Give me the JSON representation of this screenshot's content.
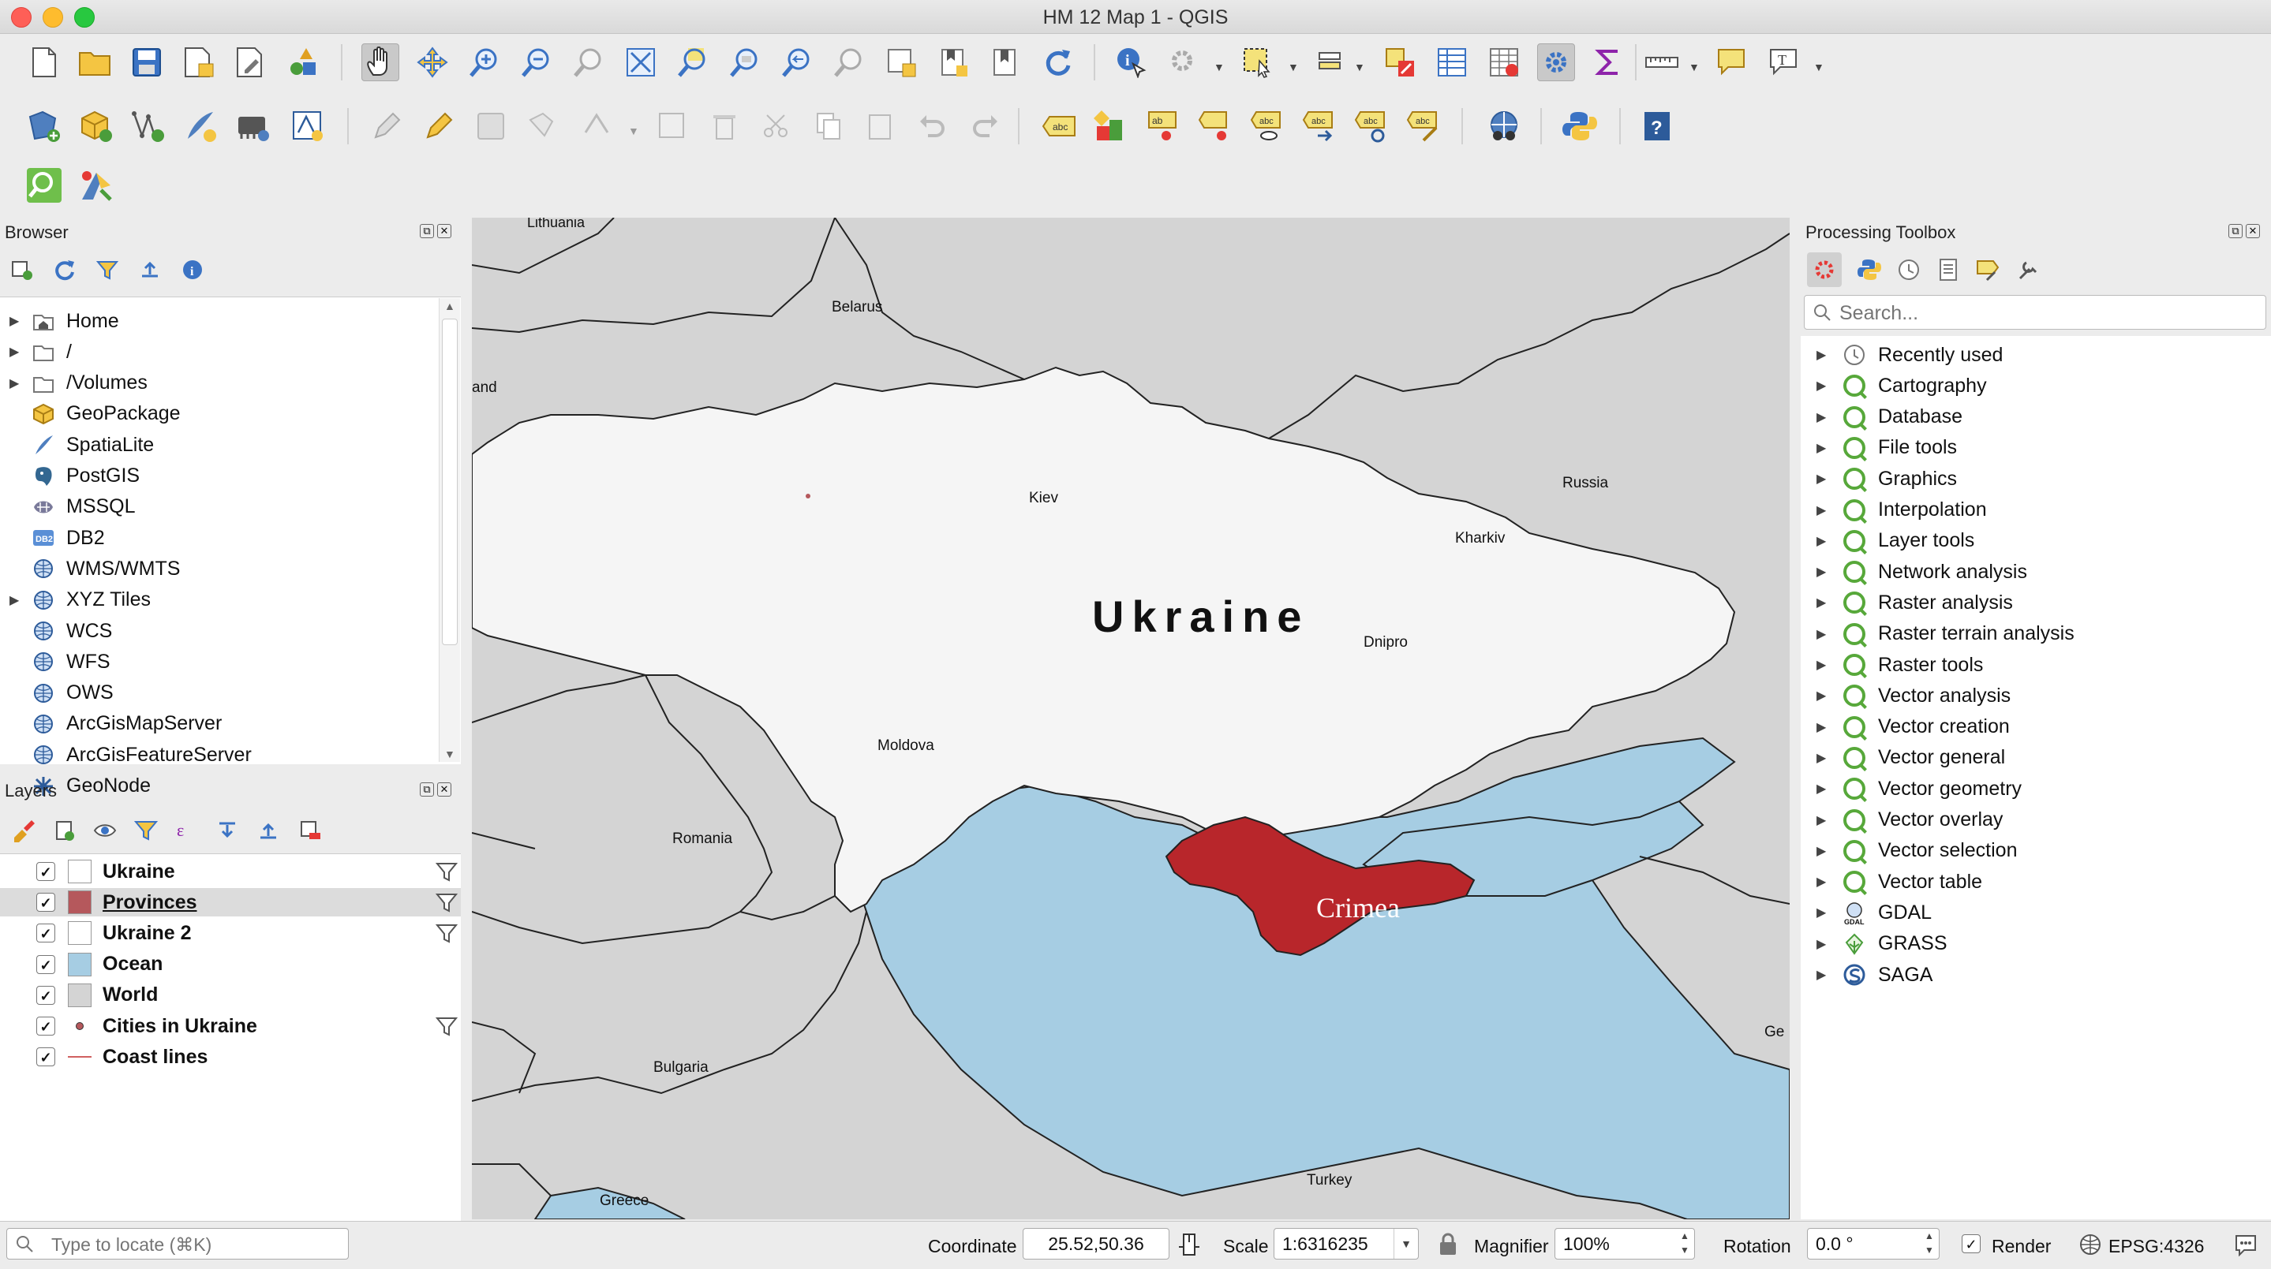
{
  "window": {
    "title": "HM 12 Map 1 - QGIS"
  },
  "toolbars": {
    "row1": [
      "new-project-icon",
      "open-project-icon",
      "save-project-icon",
      "save-as-icon",
      "print-layout-icon",
      "style-manager-icon",
      "pan-icon",
      "pan-to-selection-icon",
      "zoom-in-icon",
      "zoom-out-icon",
      "zoom-native-icon",
      "zoom-full-icon",
      "zoom-to-selection-icon",
      "zoom-to-layer-icon",
      "zoom-last-icon",
      "zoom-next-icon",
      "new-map-view-icon",
      "new-bookmark-icon",
      "show-bookmarks-icon",
      "refresh-icon",
      "identify-icon",
      "actions-icon",
      "select-features-icon",
      "select-by-value-icon",
      "deselect-icon",
      "attribute-table-icon",
      "field-calculator-icon",
      "processing-toolbox-icon",
      "statistics-icon",
      "measure-icon",
      "map-tips-icon",
      "text-annotation-icon"
    ],
    "row2": [
      "add-vector-layer-icon",
      "add-geopackage-icon",
      "add-delimited-text-icon",
      "add-spatialite-icon",
      "add-virtual-layer-icon",
      "new-shapefile-icon",
      "toggle-editing-icon",
      "current-edits-icon",
      "save-edits-icon",
      "add-feature-icon",
      "vertex-tool-icon",
      "modify-attributes-icon",
      "delete-selected-icon",
      "cut-features-icon",
      "copy-features-icon",
      "paste-features-icon",
      "undo-icon",
      "redo-icon",
      "label-tool-icon",
      "diagram-tool-icon",
      "pin-labels-icon",
      "show-hide-labels-icon",
      "move-label-icon",
      "rotate-label-icon",
      "change-label-icon",
      "georeferencer-icon",
      "python-console-icon",
      "help-icon"
    ],
    "row3": [
      "locator-icon",
      "plugin-icon"
    ]
  },
  "browser": {
    "title": "Browser",
    "items": [
      {
        "label": "Home",
        "icon": "home-folder-icon",
        "expandable": true
      },
      {
        "label": "/",
        "icon": "folder-icon",
        "expandable": true
      },
      {
        "label": "/Volumes",
        "icon": "folder-icon",
        "expandable": true
      },
      {
        "label": "GeoPackage",
        "icon": "geopackage-icon",
        "expandable": false
      },
      {
        "label": "SpatiaLite",
        "icon": "spatialite-icon",
        "expandable": false
      },
      {
        "label": "PostGIS",
        "icon": "postgis-icon",
        "expandable": false
      },
      {
        "label": "MSSQL",
        "icon": "mssql-icon",
        "expandable": false
      },
      {
        "label": "DB2",
        "icon": "db2-icon",
        "expandable": false
      },
      {
        "label": "WMS/WMTS",
        "icon": "globe-icon",
        "expandable": false
      },
      {
        "label": "XYZ Tiles",
        "icon": "globe-icon",
        "expandable": true
      },
      {
        "label": "WCS",
        "icon": "globe-icon",
        "expandable": false
      },
      {
        "label": "WFS",
        "icon": "globe-icon",
        "expandable": false
      },
      {
        "label": "OWS",
        "icon": "globe-icon",
        "expandable": false
      },
      {
        "label": "ArcGisMapServer",
        "icon": "globe-icon",
        "expandable": false
      },
      {
        "label": "ArcGisFeatureServer",
        "icon": "globe-icon",
        "expandable": false
      },
      {
        "label": "GeoNode",
        "icon": "geonode-icon",
        "expandable": false
      }
    ]
  },
  "layers": {
    "title": "Layers",
    "items": [
      {
        "label": "Ukraine",
        "checked": true,
        "swatch": "#ffffff",
        "filter": true,
        "selected": false
      },
      {
        "label": "Provinces",
        "checked": true,
        "swatch": "#b5585c",
        "filter": true,
        "selected": true
      },
      {
        "label": "Ukraine 2",
        "checked": true,
        "swatch": "#ffffff",
        "filter": true,
        "selected": false
      },
      {
        "label": "Ocean",
        "checked": true,
        "swatch": "#a6cde3",
        "filter": false,
        "selected": false
      },
      {
        "label": "World",
        "checked": true,
        "swatch": "#d4d4d4",
        "filter": false,
        "selected": false
      },
      {
        "label": "Cities in Ukraine",
        "checked": true,
        "swatch": "point",
        "filter": true,
        "selected": false
      },
      {
        "label": "Coast lines",
        "checked": true,
        "swatch": "line",
        "filter": false,
        "selected": false
      }
    ]
  },
  "map": {
    "colors": {
      "land": "#d4d4d4",
      "ukraine": "#f5f5f5",
      "sea": "#a6cde3",
      "crimea": "#b8262b"
    },
    "labels": {
      "lithuania": "Lithuania",
      "belarus": "Belarus",
      "poland": "and",
      "russia": "Russia",
      "kiev": "Kiev",
      "kharkiv": "Kharkiv",
      "dnipro": "Dnipro",
      "ukraine": "Ukraine",
      "moldova": "Moldova",
      "romania": "Romania",
      "crimea": "Crimea",
      "bulgaria": "Bulgaria",
      "turkey": "Turkey",
      "greece": "Greece",
      "georgia": "Ge"
    }
  },
  "toolbox": {
    "title": "Processing Toolbox",
    "search_placeholder": "Search...",
    "items": [
      {
        "label": "Recently used",
        "icon": "clock-icon"
      },
      {
        "label": "Cartography",
        "icon": "qgis-icon"
      },
      {
        "label": "Database",
        "icon": "qgis-icon"
      },
      {
        "label": "File tools",
        "icon": "qgis-icon"
      },
      {
        "label": "Graphics",
        "icon": "qgis-icon"
      },
      {
        "label": "Interpolation",
        "icon": "qgis-icon"
      },
      {
        "label": "Layer tools",
        "icon": "qgis-icon"
      },
      {
        "label": "Network analysis",
        "icon": "qgis-icon"
      },
      {
        "label": "Raster analysis",
        "icon": "qgis-icon"
      },
      {
        "label": "Raster terrain analysis",
        "icon": "qgis-icon"
      },
      {
        "label": "Raster tools",
        "icon": "qgis-icon"
      },
      {
        "label": "Vector analysis",
        "icon": "qgis-icon"
      },
      {
        "label": "Vector creation",
        "icon": "qgis-icon"
      },
      {
        "label": "Vector general",
        "icon": "qgis-icon"
      },
      {
        "label": "Vector geometry",
        "icon": "qgis-icon"
      },
      {
        "label": "Vector overlay",
        "icon": "qgis-icon"
      },
      {
        "label": "Vector selection",
        "icon": "qgis-icon"
      },
      {
        "label": "Vector table",
        "icon": "qgis-icon"
      },
      {
        "label": "GDAL",
        "icon": "gdal-icon"
      },
      {
        "label": "GRASS",
        "icon": "grass-icon"
      },
      {
        "label": "SAGA",
        "icon": "saga-icon"
      }
    ]
  },
  "status": {
    "locator_placeholder": "Type to locate (⌘K)",
    "coordinate_label": "Coordinate",
    "coordinate_value": "25.52,50.36",
    "scale_label": "Scale",
    "scale_value": "1:6316235",
    "magnifier_label": "Magnifier",
    "magnifier_value": "100%",
    "rotation_label": "Rotation",
    "rotation_value": "0.0 °",
    "render_label": "Render",
    "render_checked": true,
    "crs": "EPSG:4326"
  }
}
